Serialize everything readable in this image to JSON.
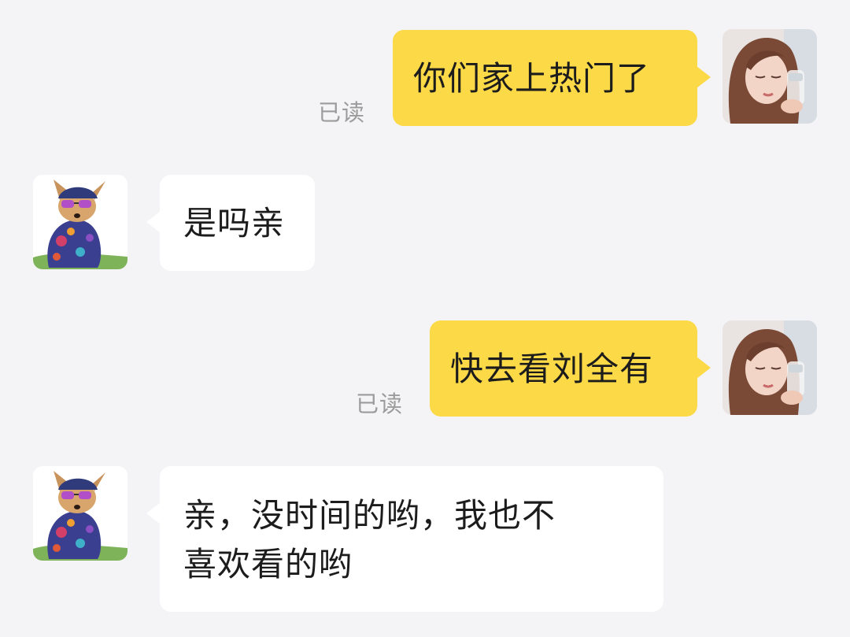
{
  "messages": [
    {
      "direction": "outgoing",
      "text": "你们家上热门了",
      "status": "已读",
      "avatar": "user-photo-avatar"
    },
    {
      "direction": "incoming",
      "text": "是吗亲",
      "avatar": "puppy-avatar"
    },
    {
      "direction": "outgoing",
      "text": "快去看刘全有",
      "status": "已读",
      "avatar": "user-photo-avatar"
    },
    {
      "direction": "incoming",
      "text_lines": [
        "亲，没时间的哟，我也不",
        "喜欢看的哟"
      ],
      "avatar": "puppy-avatar"
    }
  ],
  "colors": {
    "background": "#f4f4f6",
    "outgoing_bubble": "#fbd947",
    "incoming_bubble": "#ffffff",
    "read_status": "#9b9b9b"
  }
}
